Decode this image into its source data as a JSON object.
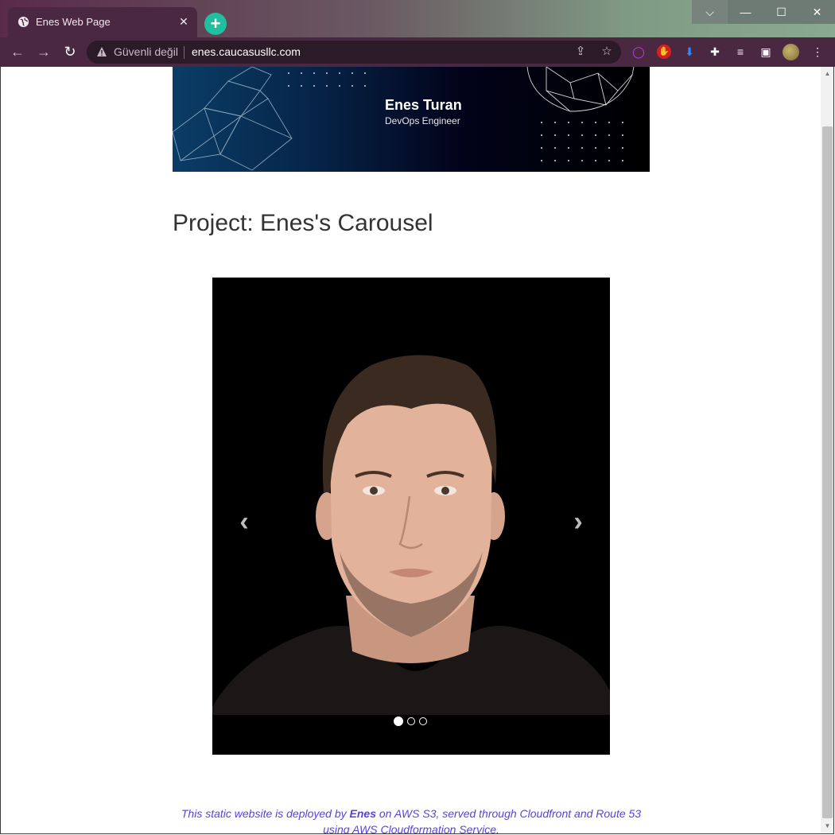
{
  "browser": {
    "tab": {
      "title": "Enes Web Page",
      "close": "✕"
    },
    "new_tab": "+",
    "window_buttons": {
      "dropdown": "⌵",
      "minimize": "—",
      "maximize": "☐",
      "close": "✕"
    },
    "nav": {
      "back": "←",
      "forward": "→",
      "reload": "↻"
    },
    "omnibox": {
      "security_label": "Güvenli değil",
      "url": "enes.caucasusllc.com"
    },
    "icons": [
      "globe-icon",
      "share-icon",
      "star-icon",
      "opera-icon",
      "adblock-icon",
      "download-icon",
      "puzzle-icon",
      "media-icon",
      "sidepanel-icon",
      "avatar",
      "kebab-menu-icon"
    ],
    "colors": {
      "tab_bg": "#4a2842",
      "new_tab": "#1fbf9f",
      "footer_text": "#5b3fe0"
    }
  },
  "banner": {
    "name": "Enes Turan",
    "role": "DevOps Engineer"
  },
  "page": {
    "title": "Project: Enes's Carousel",
    "carousel": {
      "prev": "‹",
      "next": "›",
      "slides": 3,
      "active_slide": 1
    },
    "footer": {
      "part1": "This static website is deployed by ",
      "name": "Enes",
      "part2": " on AWS S3, served through Cloudfront and Route 53 using AWS Cloudformation Service."
    }
  }
}
